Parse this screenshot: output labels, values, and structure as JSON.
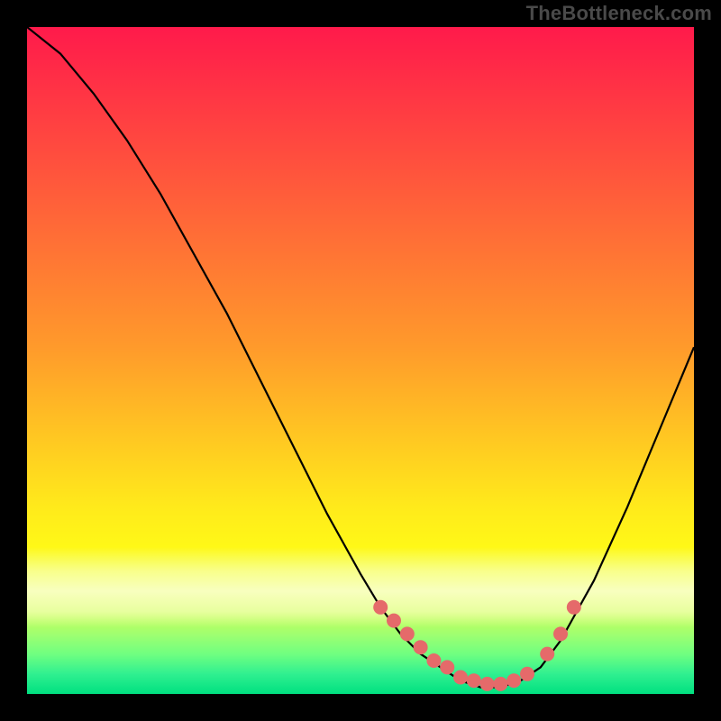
{
  "attribution": "TheBottleneck.com",
  "chart_data": {
    "type": "line",
    "title": "",
    "xlabel": "",
    "ylabel": "",
    "xlim": [
      0,
      100
    ],
    "ylim": [
      0,
      100
    ],
    "grid": false,
    "legend": false,
    "series": [
      {
        "name": "bottleneck-curve",
        "color": "#000000",
        "x": [
          0,
          5,
          10,
          15,
          20,
          25,
          30,
          35,
          40,
          45,
          50,
          53,
          56,
          59,
          62,
          65,
          68,
          71,
          74,
          77,
          80,
          85,
          90,
          95,
          100
        ],
        "y": [
          100,
          96,
          90,
          83,
          75,
          66,
          57,
          47,
          37,
          27,
          18,
          13,
          9,
          6,
          4,
          2,
          1,
          1,
          2,
          4,
          8,
          17,
          28,
          40,
          52
        ]
      }
    ],
    "markers": {
      "name": "bottleneck-points",
      "color": "#e56a6a",
      "radius": 8,
      "x": [
        53,
        55,
        57,
        59,
        61,
        63,
        65,
        67,
        69,
        71,
        73,
        75,
        78,
        80,
        82
      ],
      "y": [
        13,
        11,
        9,
        7,
        5,
        4,
        2.5,
        2,
        1.5,
        1.5,
        2,
        3,
        6,
        9,
        13
      ]
    },
    "gradient_note": "vertical heatmap background red→yellow→green (top→bottom)"
  }
}
